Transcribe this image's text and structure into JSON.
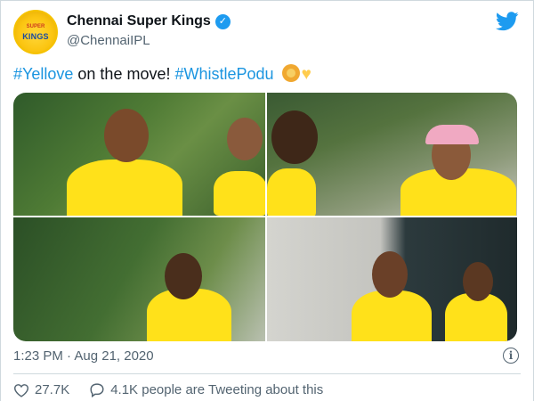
{
  "account": {
    "display_name": "Chennai Super Kings",
    "handle": "@ChennaiIPL",
    "verified": true,
    "avatar_icon": "csk-logo-icon",
    "avatar_top_text": "SUPER",
    "avatar_logo_text": "KINGS"
  },
  "tweet": {
    "text_parts": [
      {
        "text": "#Yellove",
        "type": "hashtag"
      },
      {
        "text": " on the move! ",
        "type": "text"
      },
      {
        "text": "#WhistlePodu",
        "type": "hashtag"
      }
    ],
    "emojis": [
      "lion-emoji",
      "yellow-heart-emoji"
    ],
    "hashtag_color": "#1b95e0"
  },
  "media": {
    "photos": [
      {
        "icon": "photo-1"
      },
      {
        "icon": "photo-2"
      },
      {
        "icon": "photo-3"
      },
      {
        "icon": "photo-4"
      }
    ]
  },
  "meta": {
    "timestamp": "1:23 PM · Aug 21, 2020"
  },
  "actions": {
    "likes": "27.7K",
    "replies_text": "4.1K people are Tweeting about this"
  },
  "colors": {
    "twitter_blue": "#1d9bf0",
    "csk_yellow": "#ffe11a",
    "secondary_text": "#536471"
  }
}
